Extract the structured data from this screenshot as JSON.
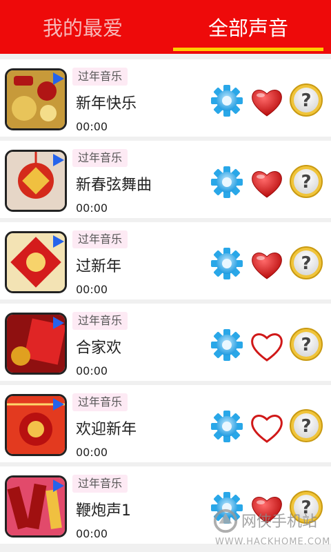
{
  "tabs": [
    {
      "label": "我的最爱",
      "active": false
    },
    {
      "label": "全部声音",
      "active": true
    }
  ],
  "colors": {
    "header": "#ee0a0a",
    "indicator": "#ffcc00",
    "heart": "#e01b1b",
    "gear": "#29a7e8"
  },
  "items": [
    {
      "tag": "过年音乐",
      "title": "新年快乐",
      "time": "00:00",
      "favorite": true,
      "thumb_colors": [
        "#c79a3a",
        "#b01515"
      ]
    },
    {
      "tag": "过年音乐",
      "title": "新春弦舞曲",
      "time": "00:00",
      "favorite": true,
      "thumb_colors": [
        "#e6d6c7",
        "#d42a1b"
      ]
    },
    {
      "tag": "过年音乐",
      "title": "过新年",
      "time": "00:00",
      "favorite": true,
      "thumb_colors": [
        "#f3e3b4",
        "#d41c1c"
      ]
    },
    {
      "tag": "过年音乐",
      "title": "合家欢",
      "time": "00:00",
      "favorite": false,
      "thumb_colors": [
        "#8f1010",
        "#e02525"
      ]
    },
    {
      "tag": "过年音乐",
      "title": "欢迎新年",
      "time": "00:00",
      "favorite": false,
      "thumb_colors": [
        "#e33a1f",
        "#b81010"
      ]
    },
    {
      "tag": "过年音乐",
      "title": "鞭炮声1",
      "time": "00:00",
      "favorite": true,
      "thumb_colors": [
        "#e24a6b",
        "#a01010"
      ]
    }
  ],
  "icons": [
    "play-icon",
    "gear-icon",
    "heart-icon",
    "help-icon"
  ],
  "watermark": {
    "cn": "网侠手机站",
    "url": "WWW.HACKHOME.COM"
  }
}
